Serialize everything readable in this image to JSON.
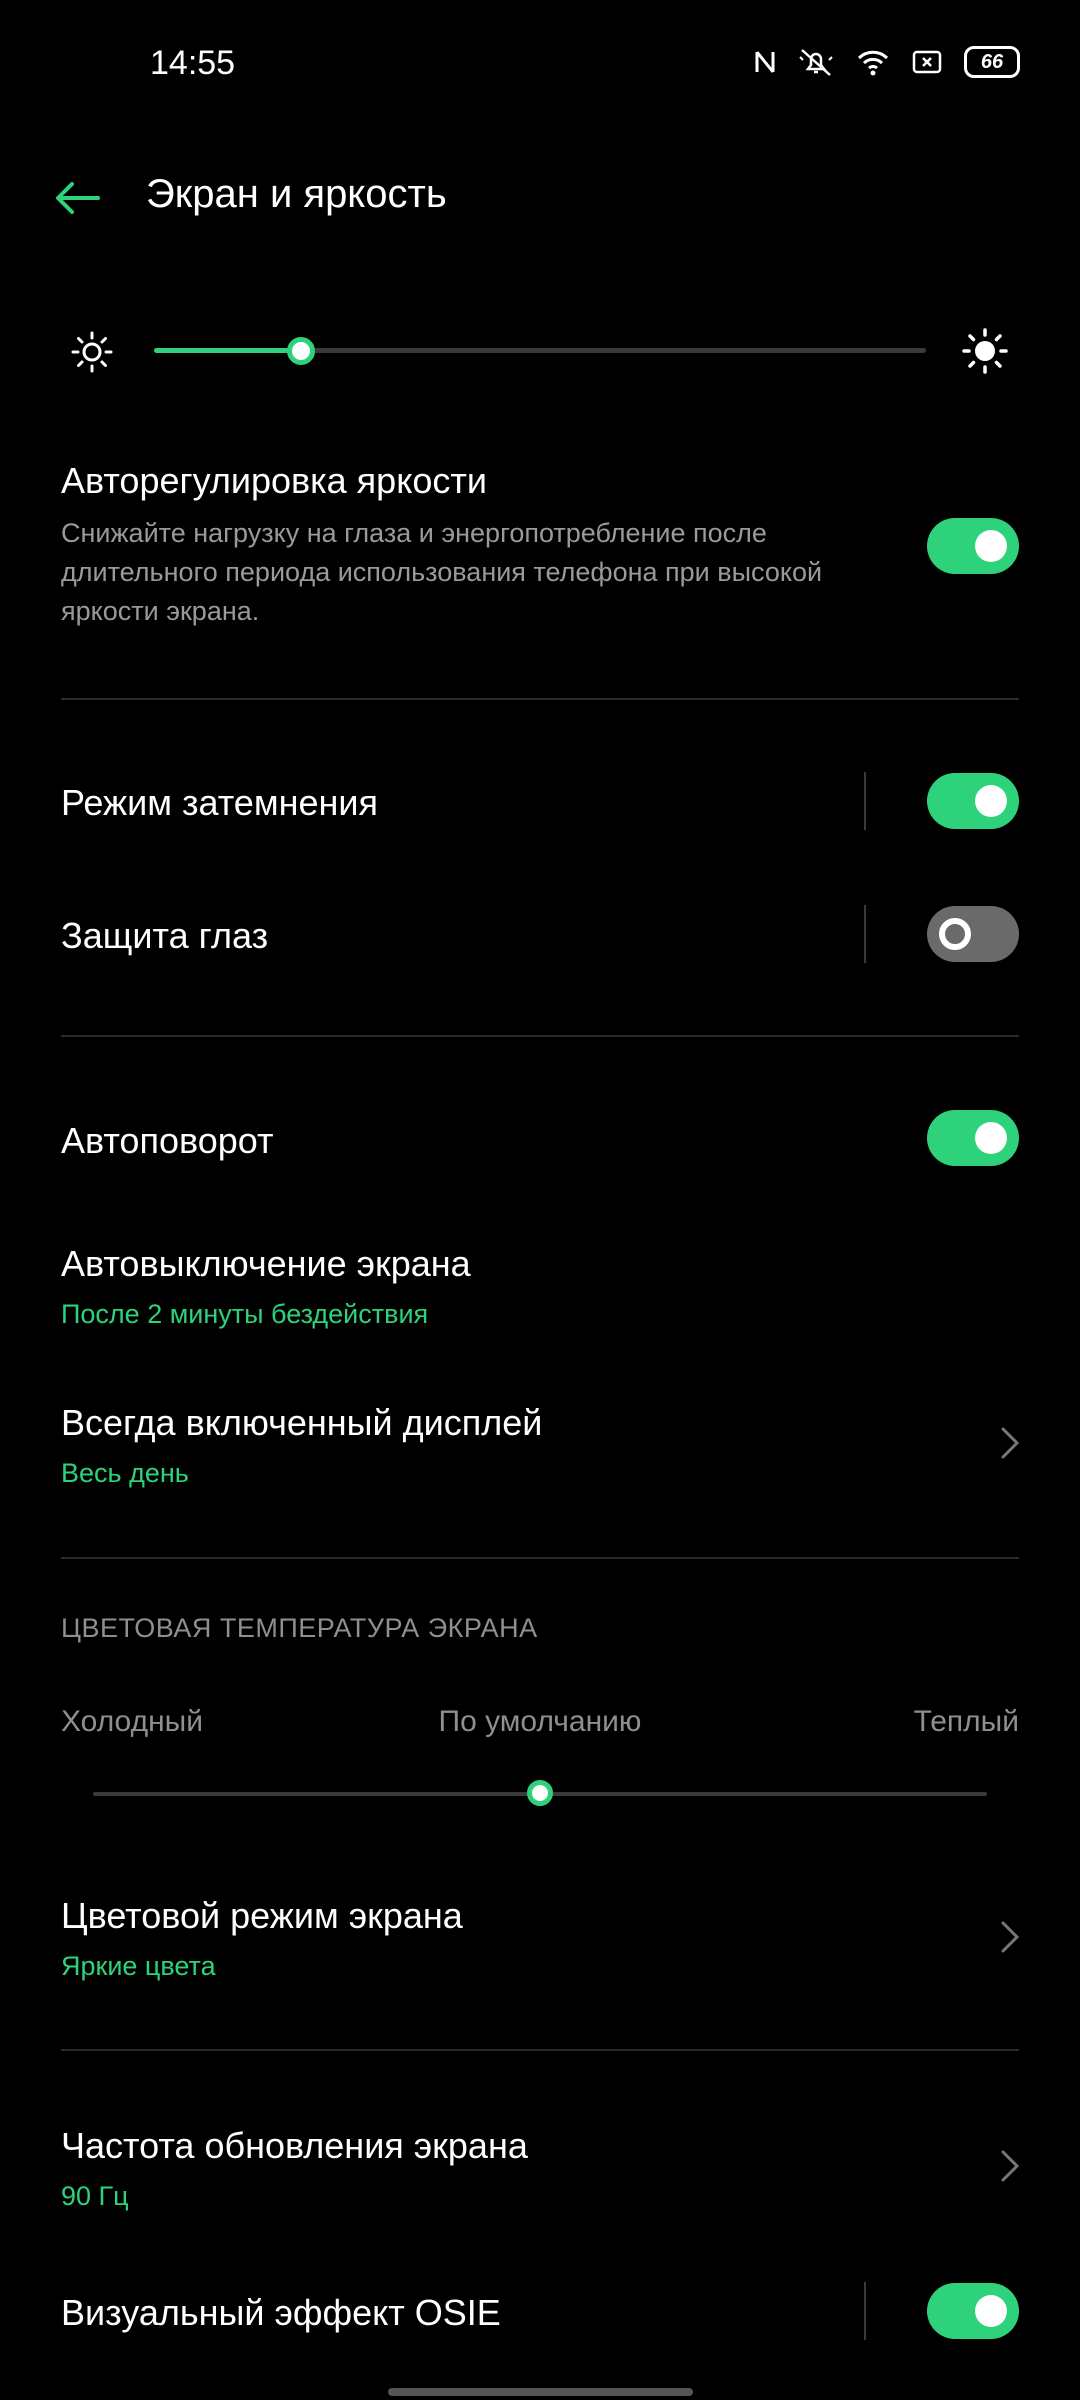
{
  "status_bar": {
    "time": "14:55",
    "battery": "66",
    "icons": [
      "nfc-icon",
      "mute-icon",
      "wifi-icon",
      "screen-record-icon",
      "battery-icon"
    ]
  },
  "header": {
    "title": "Экран и яркость",
    "back_icon": "back-arrow-icon"
  },
  "brightness": {
    "level": 0.19,
    "low_icon": "sun-outline-icon",
    "high_icon": "sun-filled-icon"
  },
  "auto_brightness": {
    "title": "Авторегулировка яркости",
    "description": "Снижайте нагрузку на глаза и энергопотребление после длительного периода использования телефона при высокой яркости экрана.",
    "enabled": true
  },
  "dim_mode": {
    "title": "Режим затемнения",
    "enabled": true
  },
  "eye_protection": {
    "title": "Защита глаз",
    "enabled": false
  },
  "auto_rotate": {
    "title": "Автоповорот",
    "enabled": true
  },
  "screen_timeout": {
    "title": "Автовыключение экрана",
    "value": "После 2 минуты бездействия"
  },
  "always_on": {
    "title": "Всегда включенный дисплей",
    "value": "Весь день"
  },
  "color_temperature": {
    "section_title": "ЦВЕТОВАЯ ТЕМПЕРАТУРА ЭКРАНА",
    "cold_label": "Холодный",
    "default_label": "По умолчанию",
    "warm_label": "Теплый",
    "level": 0.5
  },
  "color_mode": {
    "title": "Цветовой режим экрана",
    "value": "Яркие цвета"
  },
  "refresh_rate": {
    "title": "Частота обновления экрана",
    "value": "90 Гц"
  },
  "osie": {
    "title": "Визуальный эффект OSIE",
    "enabled": true
  },
  "colors": {
    "accent": "#2ed27a",
    "background": "#000000",
    "muted": "#8f8f8f"
  }
}
